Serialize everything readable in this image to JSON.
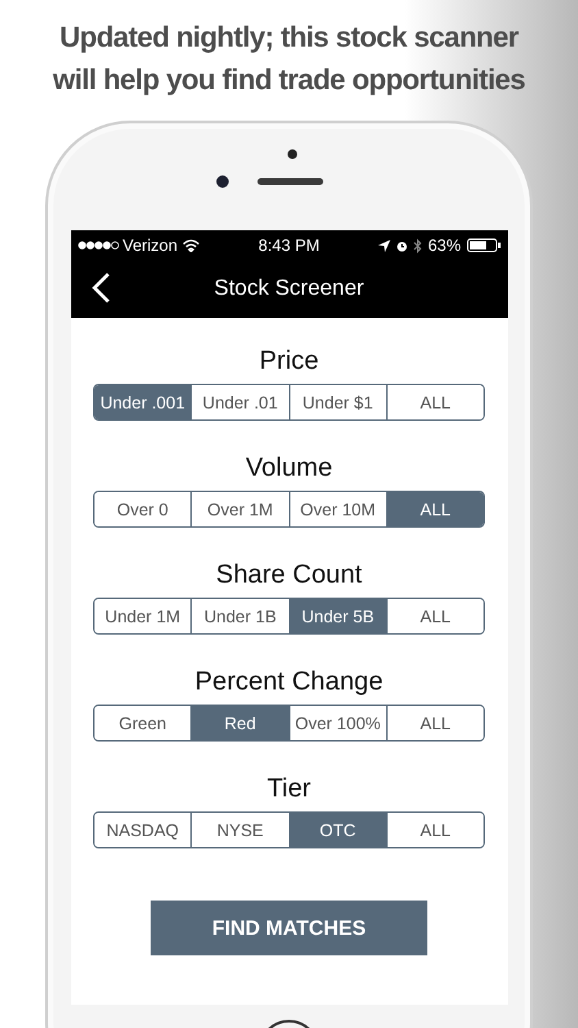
{
  "headline": [
    "Updated nightly; this stock scanner",
    "will help you find trade opportunities"
  ],
  "status_bar": {
    "carrier": "Verizon",
    "time": "8:43 PM",
    "battery": "63%"
  },
  "nav_bar": {
    "title": "Stock Screener"
  },
  "filters": [
    {
      "title": "Price",
      "options": [
        {
          "label": "Under .001",
          "selected": true
        },
        {
          "label": "Under .01",
          "selected": false
        },
        {
          "label": "Under $1",
          "selected": false
        },
        {
          "label": "ALL",
          "selected": false
        }
      ]
    },
    {
      "title": "Volume",
      "options": [
        {
          "label": "Over 0",
          "selected": false
        },
        {
          "label": "Over 1M",
          "selected": false
        },
        {
          "label": "Over 10M",
          "selected": false
        },
        {
          "label": "ALL",
          "selected": true
        }
      ]
    },
    {
      "title": "Share Count",
      "options": [
        {
          "label": "Under 1M",
          "selected": false
        },
        {
          "label": "Under 1B",
          "selected": false
        },
        {
          "label": "Under 5B",
          "selected": true
        },
        {
          "label": "ALL",
          "selected": false
        }
      ]
    },
    {
      "title": "Percent Change",
      "options": [
        {
          "label": "Green",
          "selected": false
        },
        {
          "label": "Red",
          "selected": true
        },
        {
          "label": "Over 100%",
          "selected": false
        },
        {
          "label": "ALL",
          "selected": false
        }
      ]
    },
    {
      "title": "Tier",
      "options": [
        {
          "label": "NASDAQ",
          "selected": false
        },
        {
          "label": "NYSE",
          "selected": false
        },
        {
          "label": "OTC",
          "selected": true
        },
        {
          "label": "ALL",
          "selected": false
        }
      ]
    }
  ],
  "action_button": {
    "label": "FIND MATCHES"
  }
}
